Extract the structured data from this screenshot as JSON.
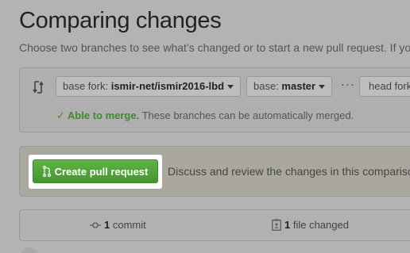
{
  "header": {
    "title": "Comparing changes",
    "subtitle": "Choose two branches to see what’s changed or to start a new pull request. If yo"
  },
  "range": {
    "base_fork_prefix": "base fork: ",
    "base_fork_value": "ismir-net/ismir2016-lbd",
    "base_prefix": "base: ",
    "base_value": "master",
    "ellipsis": "···",
    "head_fork_label": "head fork",
    "merge_ok": "Able to merge.",
    "merge_detail": " These branches can be automatically merged."
  },
  "pull_request": {
    "button_label": "Create pull request",
    "description": "Discuss and review the changes in this compariso"
  },
  "summary": {
    "commit_count": "1",
    "commit_label": " commit",
    "file_count": "1",
    "file_label": " file changed"
  },
  "colors": {
    "button_green": "#4ca534",
    "merge_green": "#3e8a2f"
  },
  "icons": [
    "compare-icon",
    "check-icon",
    "pull-request-icon",
    "commit-icon",
    "file-diff-icon"
  ]
}
